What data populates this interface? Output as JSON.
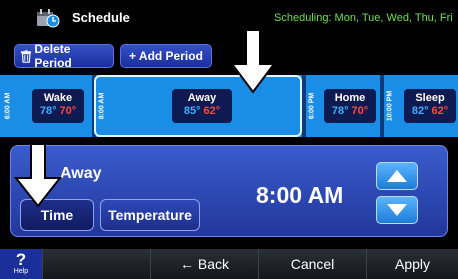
{
  "header": {
    "title": "Schedule",
    "schedule_text": "Scheduling: Mon, Tue, Wed, Thu, Fri",
    "icon": "schedule-clock-icon"
  },
  "toolbar": {
    "delete_label": "Delete Period",
    "add_label": "+ Add Period",
    "delete_icon": "trash-icon"
  },
  "periods": [
    {
      "time": "6:00 AM",
      "name": "Wake",
      "cool": "78°",
      "heat": "70°"
    },
    {
      "time": "8:00 AM",
      "name": "Away",
      "cool": "85°",
      "heat": "62°",
      "selected": true
    },
    {
      "time": "6:00 PM",
      "name": "Home",
      "cool": "78°",
      "heat": "70°"
    },
    {
      "time": "10:00 PM",
      "name": "Sleep",
      "cool": "82°",
      "heat": "62°"
    }
  ],
  "editor": {
    "period_name": "Away",
    "time_value": "8:00 AM",
    "tabs": {
      "time": "Time",
      "temperature": "Temperature"
    }
  },
  "bottom_bar": {
    "help_label": "Help",
    "help_symbol": "?",
    "back_label": "← Back",
    "cancel_label": "Cancel",
    "apply_label": "Apply"
  },
  "colors": {
    "accent_blue": "#1a8de6",
    "cool_temp": "#3fb0ff",
    "heat_temp": "#ff4a3a",
    "schedule_text": "#6ee04a"
  }
}
